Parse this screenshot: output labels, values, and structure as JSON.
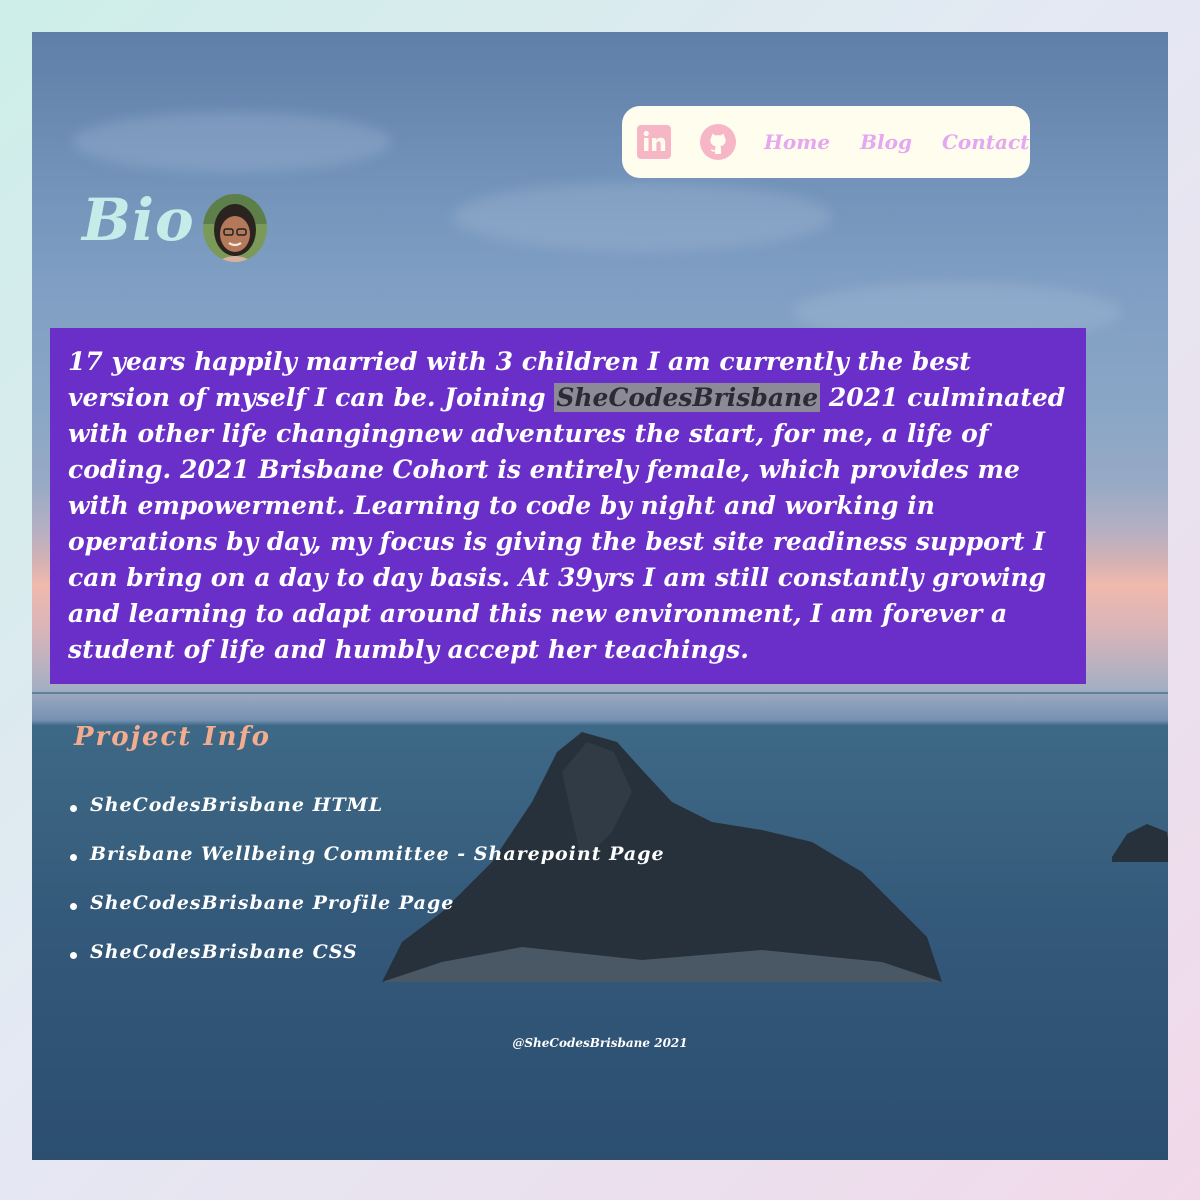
{
  "nav": {
    "icons": {
      "linkedin": "linkedin-icon",
      "github": "github-icon"
    },
    "links": [
      "Home",
      "Blog",
      "Contact"
    ]
  },
  "header": {
    "title": "Bio"
  },
  "bio": {
    "text_before": "17 years happily married with 3 children I am currently the best version of myself I can be. Joining ",
    "highlight": "SheCodesBrisbane",
    "text_after": " 2021 culminated with other life changingnew adventures the start, for me, a life of coding. 2021 Brisbane Cohort is entirely female, which provides me with empowerment. Learning to code by night and working in operations by day, my focus is giving the best site readiness support I can bring on a day to day basis. At 39yrs I am still constantly growing and learning to adapt around this new environment, I am forever a student of life and humbly accept her teachings."
  },
  "project_info": {
    "title": "Project Info",
    "items": [
      "SheCodesBrisbane HTML",
      "Brisbane Wellbeing Committee - Sharepoint Page",
      "SheCodesBrisbane Profile Page",
      "SheCodesBrisbane CSS"
    ]
  },
  "footer": {
    "text": "@SheCodesBrisbane 2021"
  },
  "colors": {
    "nav_bg": "#fffdee",
    "nav_link": "#e5a8f0",
    "icon_pink": "#f6b6c6",
    "bio_title": "#c6ecea",
    "bio_box": "#6a2fc9",
    "project_title": "#f4ac8e"
  }
}
